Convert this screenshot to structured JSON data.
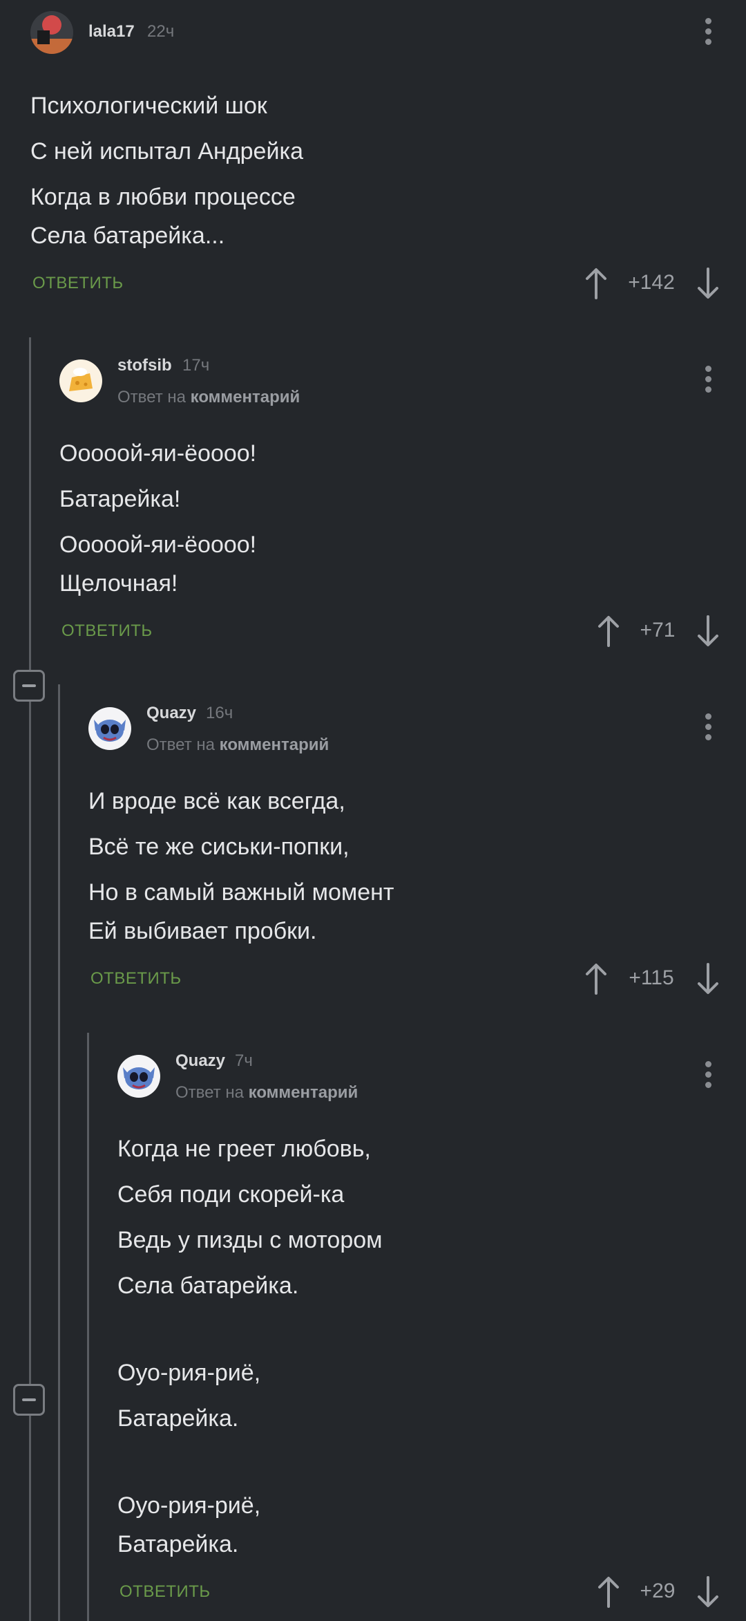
{
  "comments": [
    {
      "username": "lala17",
      "time": "22ч",
      "reply_to": null,
      "lines": [
        "Психологический шок",
        "С ней испытал Андрейка",
        "Когда в любви процессе",
        "Села батарейка..."
      ],
      "reply_label": "ОТВЕТИТЬ",
      "rating": "+142",
      "avatar_icon": "user-avatar-dark"
    },
    {
      "username": "stofsib",
      "time": "17ч",
      "reply_to": {
        "prefix": "Ответ на",
        "target": "комментарий"
      },
      "lines": [
        "Ооооой-яи-ёоооо!",
        "Батарейка!",
        "Ооооой-яи-ёоооо!",
        "Щелочная!"
      ],
      "reply_label": "ОТВЕТИТЬ",
      "rating": "+71",
      "avatar_icon": "cheese-avatar"
    },
    {
      "username": "Quazy",
      "time": "16ч",
      "reply_to": {
        "prefix": "Ответ на",
        "target": "комментарий"
      },
      "lines": [
        "И вроде всё как всегда,",
        "Всё те же сиськи-попки,",
        "Но в самый важный момент",
        "Ей выбивает пробки."
      ],
      "reply_label": "ОТВЕТИТЬ",
      "rating": "+115",
      "avatar_icon": "stitch-avatar"
    },
    {
      "username": "Quazy",
      "time": "7ч",
      "reply_to": {
        "prefix": "Ответ на",
        "target": "комментарий"
      },
      "lines": [
        "Когда не греет любовь,",
        "Себя поди скорей-ка",
        "Ведь у пизды с мотором",
        "Села батарейка.",
        "",
        "Оуо-рия-риё,",
        "Батарейка.",
        "",
        "Оуо-рия-риё,",
        "Батарейка."
      ],
      "reply_label": "ОТВЕТИТЬ",
      "rating": "+29",
      "avatar_icon": "stitch-avatar"
    }
  ],
  "colors": {
    "background": "#24272b",
    "reply_accent": "#6a9a4a",
    "thread_line": "#5a5d62"
  }
}
